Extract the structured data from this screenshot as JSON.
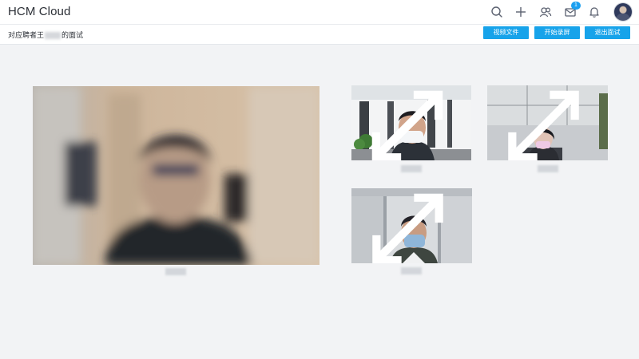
{
  "app": {
    "title": "HCM Cloud"
  },
  "topbar": {
    "icons": [
      "search-icon",
      "plus-icon",
      "contacts-icon",
      "mail-icon",
      "notification-bell-icon",
      "avatar"
    ],
    "mail_badge": "1"
  },
  "subbar": {
    "title_prefix": "对应聘者王",
    "title_suffix": "的面试",
    "buttons": [
      {
        "label": "视频文件"
      },
      {
        "label": "开始录屏"
      },
      {
        "label": "退出面试"
      }
    ]
  },
  "colors": {
    "accent": "#17a3ea",
    "page_bg": "#f2f3f5",
    "topbar_bg": "#ffffff"
  }
}
